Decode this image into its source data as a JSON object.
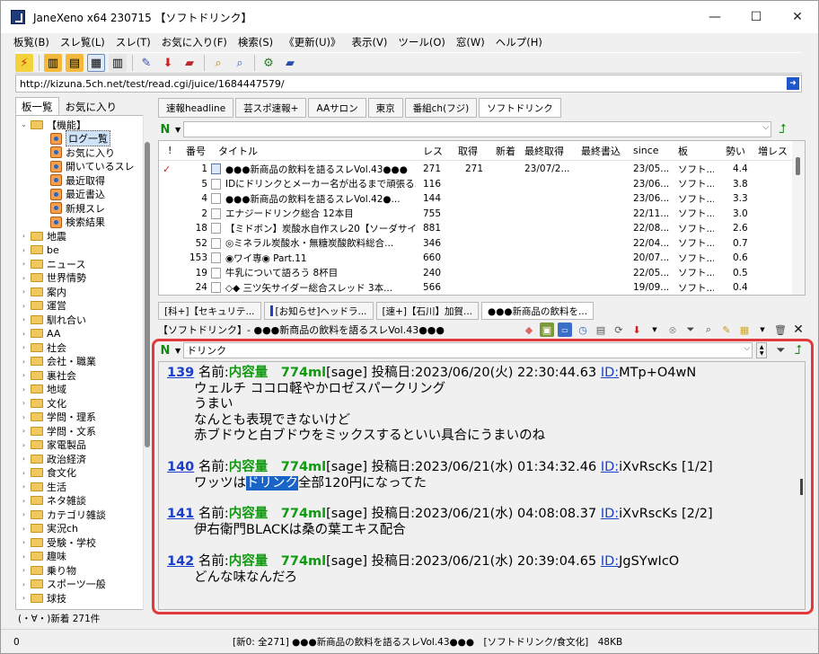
{
  "window": {
    "title": "JaneXeno x64 230715 【ソフトドリンク】",
    "controls": [
      "—",
      "☐",
      "✕"
    ]
  },
  "menu": [
    "板覧(B)",
    "スレ覧(L)",
    "スレ(T)",
    "お気に入り(F)",
    "検索(S)",
    "《更新(U)》",
    "表示(V)",
    "ツール(O)",
    "窓(W)",
    "ヘルプ(H)"
  ],
  "toolbar_icons": [
    "lightning-icon",
    "pane-icon",
    "pane-icon",
    "pane-icon",
    "pane-icon",
    "pencil-icon",
    "down-arrow-icon",
    "book-icon",
    "search-icon",
    "search-icon",
    "gear-icon",
    "book-icon"
  ],
  "address": {
    "url": "http://kizuna.5ch.net/test/read.cgi/juice/1684447579/"
  },
  "left_tabs": [
    "板一覧",
    "お気に入り"
  ],
  "tree": [
    {
      "label": "【機能】",
      "type": "folder",
      "expand": "minus",
      "level": 1
    },
    {
      "label": "ログ一覧",
      "type": "doc",
      "level": 2,
      "selected": true
    },
    {
      "label": "お気に入り",
      "type": "doc",
      "level": 2
    },
    {
      "label": "開いているスレ",
      "type": "doc",
      "level": 2
    },
    {
      "label": "最近取得",
      "type": "doc",
      "level": 2
    },
    {
      "label": "最近書込",
      "type": "doc",
      "level": 2
    },
    {
      "label": "新規スレ",
      "type": "doc",
      "level": 2
    },
    {
      "label": "検索結果",
      "type": "doc",
      "level": 2
    },
    {
      "label": "地震",
      "type": "folder",
      "expand": "plus",
      "level": 1
    },
    {
      "label": "be",
      "type": "folder",
      "expand": "plus",
      "level": 1
    },
    {
      "label": "ニュース",
      "type": "folder",
      "expand": "plus",
      "level": 1
    },
    {
      "label": "世界情勢",
      "type": "folder",
      "expand": "plus",
      "level": 1
    },
    {
      "label": "案内",
      "type": "folder",
      "expand": "plus",
      "level": 1
    },
    {
      "label": "運営",
      "type": "folder",
      "expand": "plus",
      "level": 1
    },
    {
      "label": "馴れ合い",
      "type": "folder",
      "expand": "plus",
      "level": 1
    },
    {
      "label": "AA",
      "type": "folder",
      "expand": "plus",
      "level": 1
    },
    {
      "label": "社会",
      "type": "folder",
      "expand": "plus",
      "level": 1
    },
    {
      "label": "会社・職業",
      "type": "folder",
      "expand": "plus",
      "level": 1
    },
    {
      "label": "裏社会",
      "type": "folder",
      "expand": "plus",
      "level": 1
    },
    {
      "label": "地域",
      "type": "folder",
      "expand": "plus",
      "level": 1
    },
    {
      "label": "文化",
      "type": "folder",
      "expand": "plus",
      "level": 1
    },
    {
      "label": "学問・理系",
      "type": "folder",
      "expand": "plus",
      "level": 1
    },
    {
      "label": "学問・文系",
      "type": "folder",
      "expand": "plus",
      "level": 1
    },
    {
      "label": "家電製品",
      "type": "folder",
      "expand": "plus",
      "level": 1
    },
    {
      "label": "政治経済",
      "type": "folder",
      "expand": "plus",
      "level": 1
    },
    {
      "label": "食文化",
      "type": "folder",
      "expand": "plus",
      "level": 1
    },
    {
      "label": "生活",
      "type": "folder",
      "expand": "plus",
      "level": 1
    },
    {
      "label": "ネタ雑談",
      "type": "folder",
      "expand": "plus",
      "level": 1
    },
    {
      "label": "カテゴリ雑談",
      "type": "folder",
      "expand": "plus",
      "level": 1
    },
    {
      "label": "実況ch",
      "type": "folder",
      "expand": "plus",
      "level": 1
    },
    {
      "label": "受験・学校",
      "type": "folder",
      "expand": "plus",
      "level": 1
    },
    {
      "label": "趣味",
      "type": "folder",
      "expand": "plus",
      "level": 1
    },
    {
      "label": "乗り物",
      "type": "folder",
      "expand": "plus",
      "level": 1
    },
    {
      "label": "スポーツ一般",
      "type": "folder",
      "expand": "plus",
      "level": 1
    },
    {
      "label": "球技",
      "type": "folder",
      "expand": "plus",
      "level": 1
    }
  ],
  "left_status": "(・∀・)新着 271件",
  "board_tabs": [
    {
      "label": "速報headline"
    },
    {
      "label": "芸スポ速報+"
    },
    {
      "label": "AAサロン"
    },
    {
      "label": "東京"
    },
    {
      "label": "番組ch(フジ)"
    },
    {
      "label": "ソフトドリンク",
      "active": true
    }
  ],
  "list_filter": {
    "value": ""
  },
  "thread_list": {
    "headers": [
      "!",
      "番号",
      "タイトル",
      "レス",
      "取得",
      "新着",
      "最終取得",
      "最終書込",
      "since",
      "板",
      "勢い",
      "増レス"
    ],
    "rows": [
      {
        "mark": "✓",
        "num": "1",
        "icon": "new",
        "title": "●●●新商品の飲料を語るスレVol.43●●●",
        "res": "271",
        "got": "271",
        "new": "",
        "last_get": "23/07/2...",
        "last_post": "",
        "since": "23/05...",
        "board": "ソフト...",
        "speed": "4.4"
      },
      {
        "mark": "",
        "num": "5",
        "icon": "page",
        "title": "IDにドリンクとメーカー名が出るまで頑張る...",
        "res": "116",
        "got": "",
        "new": "",
        "last_get": "",
        "last_post": "",
        "since": "23/06...",
        "board": "ソフト...",
        "speed": "3.8"
      },
      {
        "mark": "",
        "num": "4",
        "icon": "page",
        "title": "●●●新商品の飲料を語るスレVol.42●...",
        "res": "144",
        "got": "",
        "new": "",
        "last_get": "",
        "last_post": "",
        "since": "23/06...",
        "board": "ソフト...",
        "speed": "3.3"
      },
      {
        "mark": "",
        "num": "2",
        "icon": "page",
        "title": "エナジードリンク総合 12本目",
        "res": "755",
        "got": "",
        "new": "",
        "last_get": "",
        "last_post": "",
        "since": "22/11...",
        "board": "ソフト...",
        "speed": "3.0"
      },
      {
        "mark": "",
        "num": "18",
        "icon": "page",
        "title": "【ミドボン】炭酸水自作スレ20【ソーダサイ...",
        "res": "881",
        "got": "",
        "new": "",
        "last_get": "",
        "last_post": "",
        "since": "22/08...",
        "board": "ソフト...",
        "speed": "2.6"
      },
      {
        "mark": "",
        "num": "52",
        "icon": "page",
        "title": "◎ミネラル炭酸水・無糖炭酸飲料総合...",
        "res": "346",
        "got": "",
        "new": "",
        "last_get": "",
        "last_post": "",
        "since": "22/04...",
        "board": "ソフト...",
        "speed": "0.7"
      },
      {
        "mark": "",
        "num": "153",
        "icon": "page",
        "title": "◉ワイ専◉ Part.11",
        "res": "660",
        "got": "",
        "new": "",
        "last_get": "",
        "last_post": "",
        "since": "20/07...",
        "board": "ソフト...",
        "speed": "0.6"
      },
      {
        "mark": "",
        "num": "19",
        "icon": "page",
        "title": "牛乳について語ろう 8杯目",
        "res": "240",
        "got": "",
        "new": "",
        "last_get": "",
        "last_post": "",
        "since": "22/05...",
        "board": "ソフト...",
        "speed": "0.5"
      },
      {
        "mark": "",
        "num": "24",
        "icon": "page",
        "title": "◇◆ 三ツ矢サイダー総合スレッド 3本...",
        "res": "566",
        "got": "",
        "new": "",
        "last_get": "",
        "last_post": "",
        "since": "19/09...",
        "board": "ソフト...",
        "speed": "0.4"
      }
    ]
  },
  "thread_tabs": [
    {
      "label": "[科+]【セキュリテ..."
    },
    {
      "label": "[お知らせ]ヘッドラ...",
      "marker": true
    },
    {
      "label": "[速+]【石川】加賀..."
    },
    {
      "label": "●●●新商品の飲料を...",
      "active": true
    }
  ],
  "thread_title": "【ソフトドリンク】- ●●●新商品の飲料を語るスレVol.43●●●",
  "read_filter": {
    "value": "ドリンク"
  },
  "posts": [
    {
      "num": "139",
      "name_label": "名前:",
      "name": "内容量　774ml",
      "mail": "[sage]",
      "date": "投稿日:2023/06/20(火) 22:30:44.63",
      "id_label": "ID:",
      "id": "MTp+O4wN",
      "lines": [
        "ウェルチ ココロ軽やかロゼスパークリング",
        "うまい",
        "なんとも表現できないけど",
        "赤ブドウと白ブドウをミックスするといい具合にうまいのね"
      ]
    },
    {
      "num": "140",
      "name_label": "名前:",
      "name": "内容量　774ml",
      "mail": "[sage]",
      "date": "投稿日:2023/06/21(水) 01:34:32.46",
      "id_label": "ID:",
      "id": "iXvRscKs [1/2]",
      "body_pre": "ワッツは",
      "body_hl": "ドリンク",
      "body_post": "全部120円になってた"
    },
    {
      "num": "141",
      "name_label": "名前:",
      "name": "内容量　774ml",
      "mail": "[sage]",
      "date": "投稿日:2023/06/21(水) 04:08:08.37",
      "id_label": "ID:",
      "id": "iXvRscKs [2/2]",
      "lines": [
        "伊右衛門BLACKは桑の葉エキス配合"
      ]
    },
    {
      "num": "142",
      "name_label": "名前:",
      "name": "内容量　774ml",
      "mail": "[sage]",
      "date": "投稿日:2023/06/21(水) 20:39:04.65",
      "id_label": "ID:",
      "id": "JgSYwIcO",
      "lines": [
        "どんな味なんだろ"
      ]
    }
  ],
  "status": {
    "left": "0",
    "middle": "[新0: 全271] ●●●新商品の飲料を語るスレVol.43●●●　[ソフトドリンク/食文化]　48KB"
  },
  "colors": {
    "accent_red": "#e23a3a",
    "link_blue": "#1a3fc9",
    "name_green": "#119911",
    "highlight": "#1a64c8"
  }
}
